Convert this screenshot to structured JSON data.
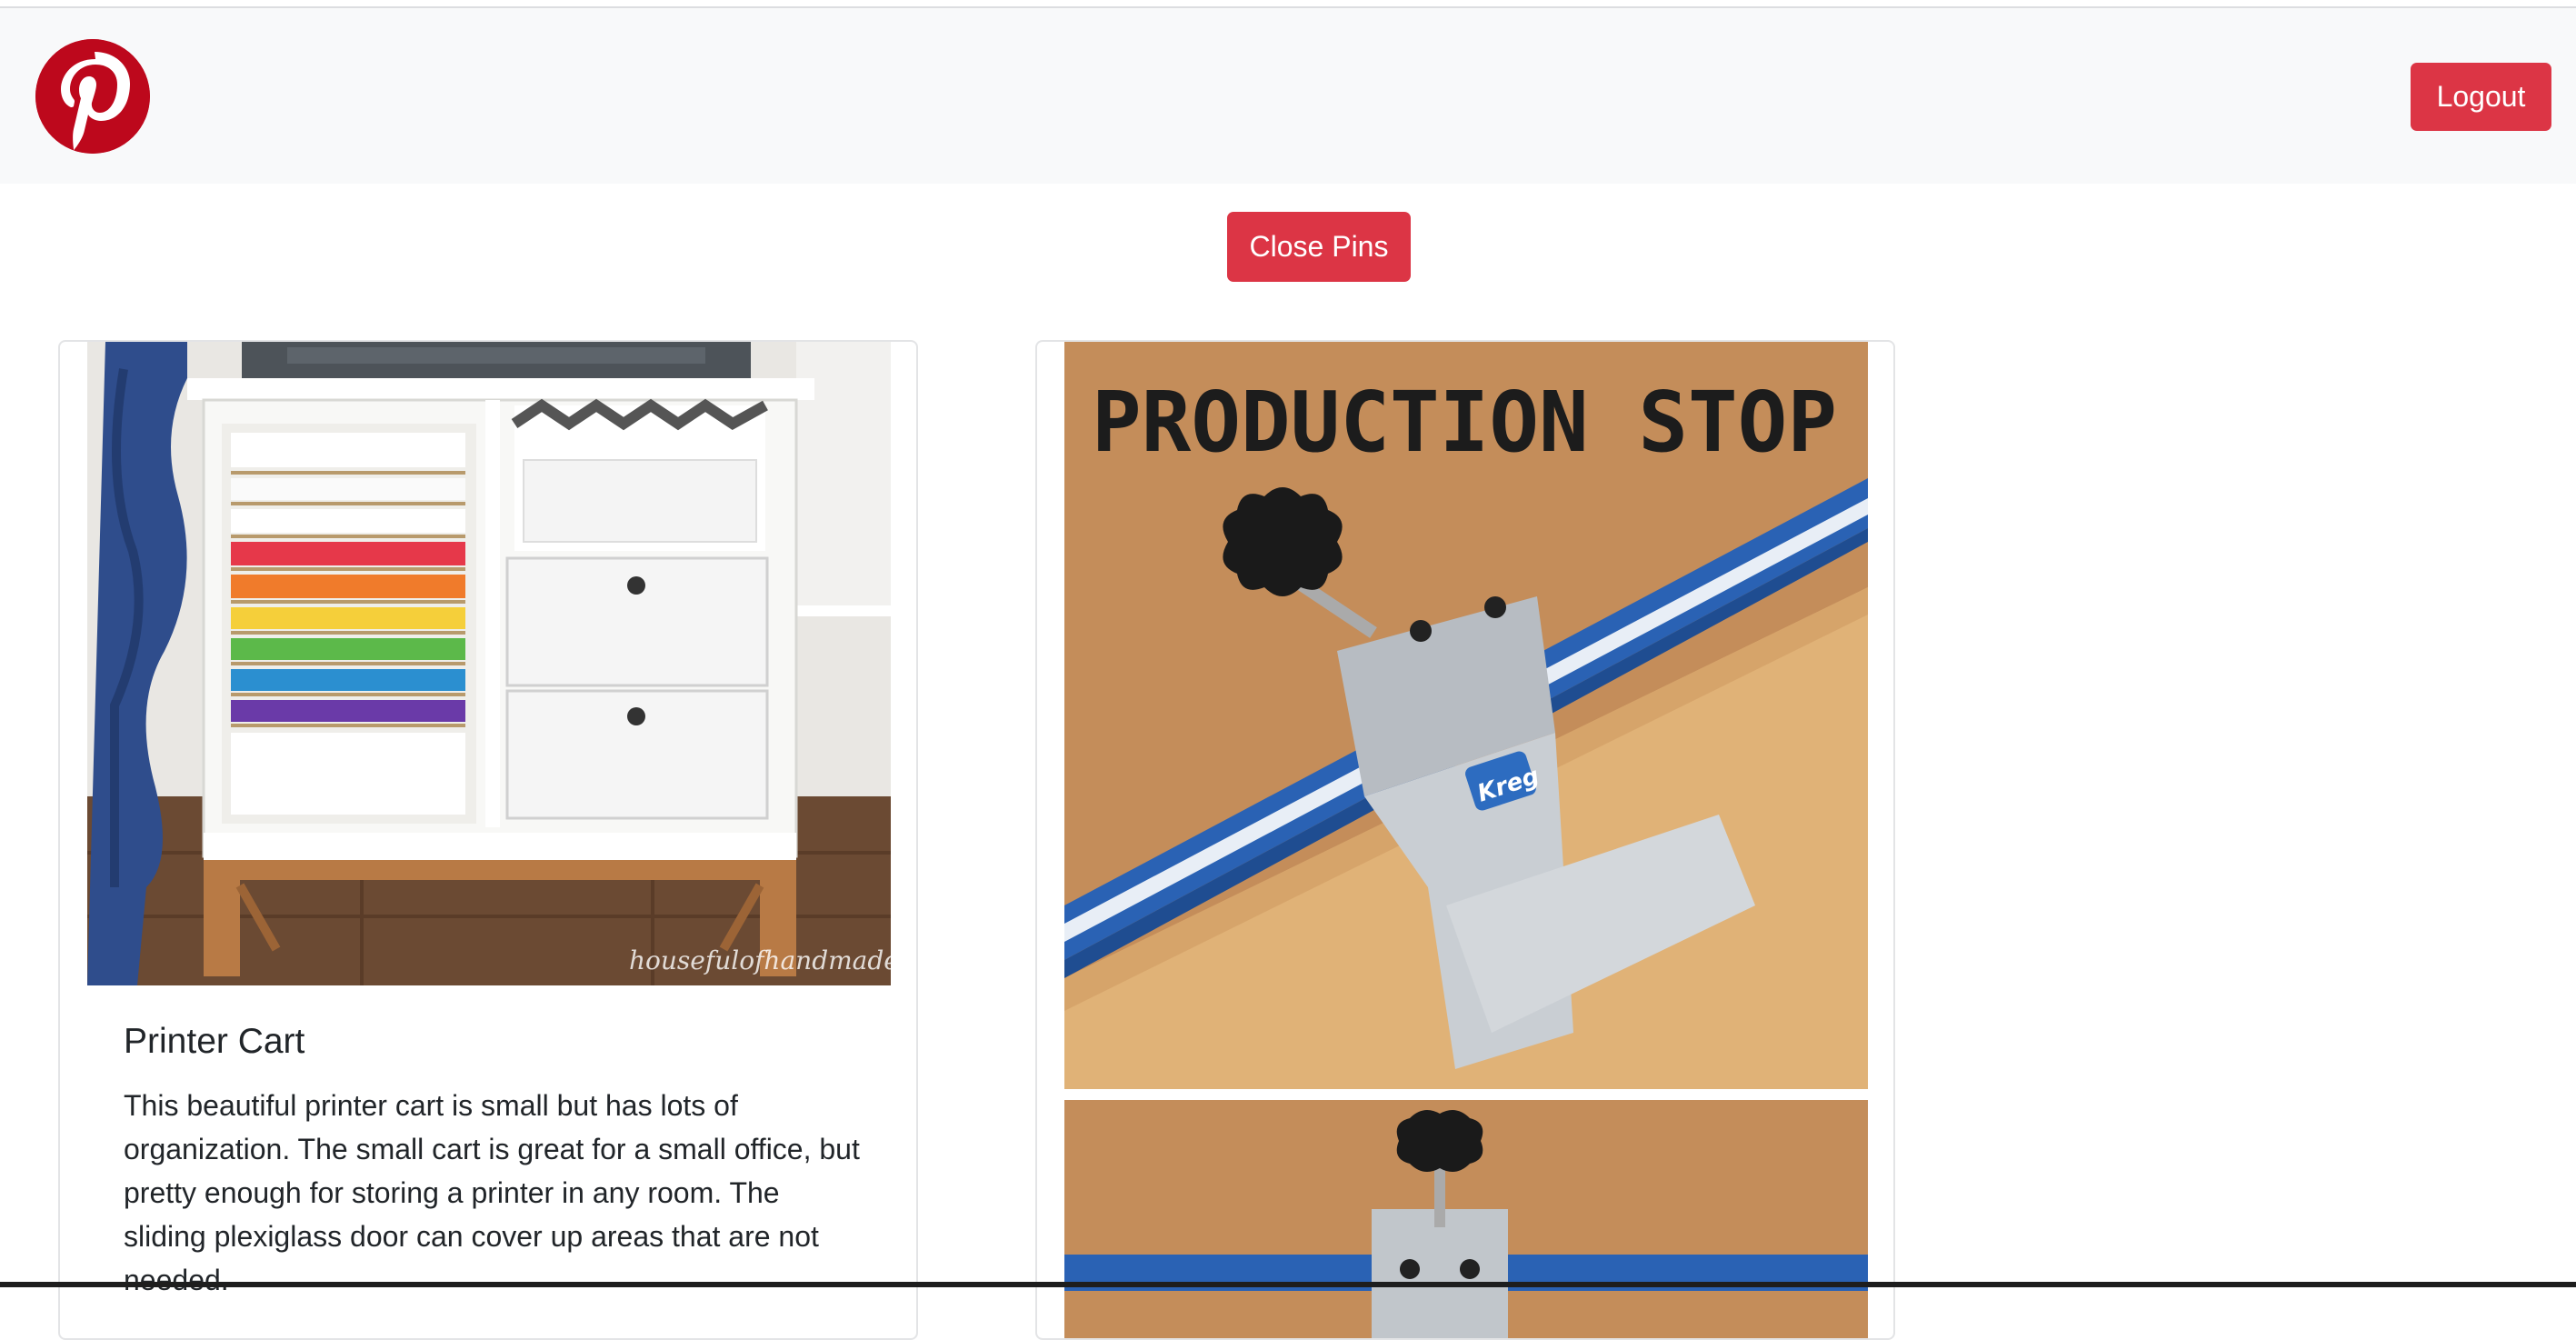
{
  "navbar": {
    "logo_icon": "pinterest-logo-icon",
    "logout_label": "Logout"
  },
  "toolbar": {
    "close_pins_label": "Close Pins"
  },
  "colors": {
    "danger": "#dc3545",
    "brand": "#bd081c",
    "navbar_bg": "#f8f9fa"
  },
  "pins": [
    {
      "title": "Printer Cart",
      "description": "This beautiful printer cart is small but has lots of organization. The small cart is great for a small office, but pretty enough for storing a printer in any room. The sliding plexiglass door can cover up areas that are not needed.",
      "image_watermark": "housefulofhandmade.com"
    },
    {
      "image_heading": "PRODUCTION STOP",
      "image_brand": "Kreg"
    }
  ]
}
